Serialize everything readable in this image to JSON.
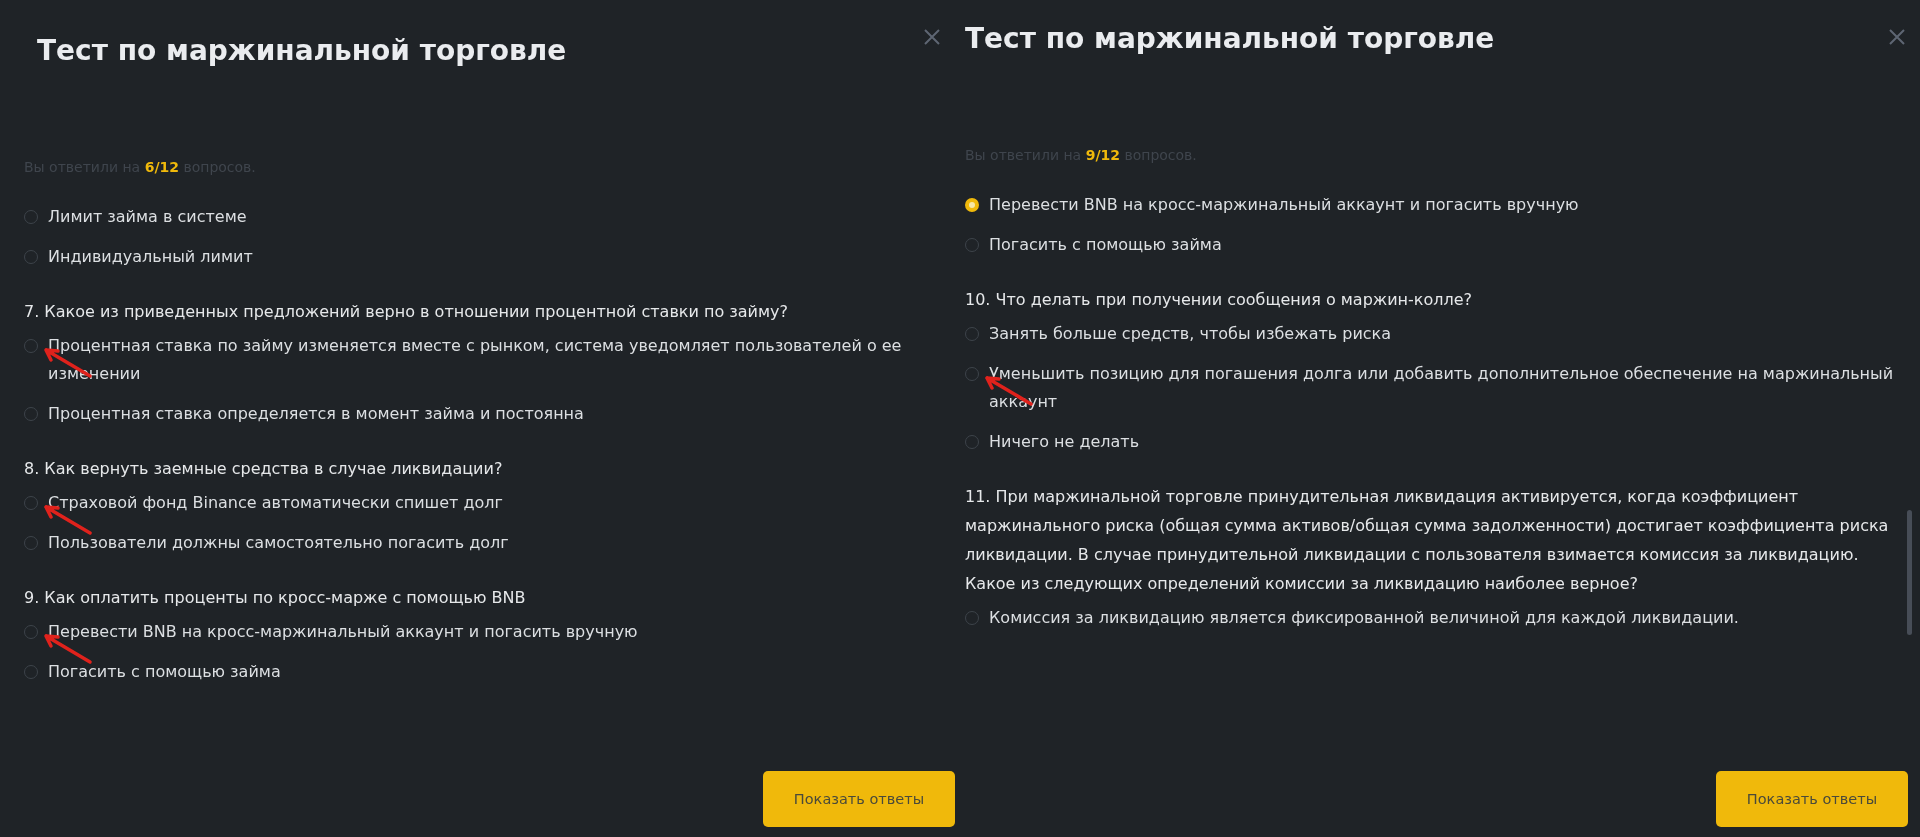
{
  "panels": [
    {
      "title": "Тест по маржинальной торговле",
      "progress": {
        "before": "Вы ответили на",
        "count": "6/12",
        "after": "вопросов."
      },
      "groups": [
        {
          "options": [
            {
              "label": "Лимит займа в системе",
              "selected": false,
              "marked": false
            },
            {
              "label": "Индивидуальный лимит",
              "selected": false,
              "marked": false
            }
          ]
        },
        {
          "question": "7. Какое из приведенных предложений верно в отношении процентной ставки по займу?",
          "options": [
            {
              "label": "Процентная ставка по займу изменяется вместе с рынком, система уведомляет пользователей о ее изменении",
              "selected": false,
              "marked": true
            },
            {
              "label": "Процентная ставка определяется в момент займа и постоянна",
              "selected": false,
              "marked": false
            }
          ]
        },
        {
          "question": "8. Как вернуть заемные средства в случае ликвидации?",
          "options": [
            {
              "label": "Страховой фонд Binance автоматически спишет долг",
              "selected": false,
              "marked": true
            },
            {
              "label": "Пользователи должны самостоятельно погасить долг",
              "selected": false,
              "marked": false
            }
          ]
        },
        {
          "question": "9. Как оплатить проценты по кросс-марже с помощью BNB",
          "options": [
            {
              "label": "Перевести BNB на кросс-маржинальный аккаунт и погасить вручную",
              "selected": false,
              "marked": true
            },
            {
              "label": "Погасить с помощью займа",
              "selected": false,
              "marked": false
            }
          ]
        }
      ],
      "button": "Показать ответы"
    },
    {
      "title": "Тест по маржинальной торговле",
      "progress": {
        "before": "Вы ответили на",
        "count": "9/12",
        "after": "вопросов."
      },
      "groups": [
        {
          "options": [
            {
              "label": "Перевести BNB на кросс-маржинальный аккаунт и погасить вручную",
              "selected": true,
              "marked": false
            },
            {
              "label": "Погасить с помощью займа",
              "selected": false,
              "marked": false
            }
          ]
        },
        {
          "question": "10. Что делать при получении сообщения о маржин-колле?",
          "options": [
            {
              "label": "Занять больше средств, чтобы избежать риска",
              "selected": false,
              "marked": false
            },
            {
              "label": "Уменьшить позицию для погашения долга или добавить дополнительное обеспечение на маржинальный аккаунт",
              "selected": false,
              "marked": true
            },
            {
              "label": "Ничего не делать",
              "selected": false,
              "marked": false
            }
          ]
        },
        {
          "question": "11. При маржинальной торговле принудительная ликвидация активируется, когда коэффициент маржинального риска (общая сумма активов/общая сумма задолженности) достигает коэффициента риска ликвидации. В случае принудительной ликвидации с пользователя взимается комиссия за ликвидацию. Какое из следующих определений комиссии за ликвидацию наиболее верное?",
          "options": [
            {
              "label": "Комиссия за ликвидацию является фиксированной величиной для каждой ликвидации.",
              "selected": false,
              "marked": false
            }
          ]
        }
      ],
      "button": "Показать ответы"
    }
  ]
}
